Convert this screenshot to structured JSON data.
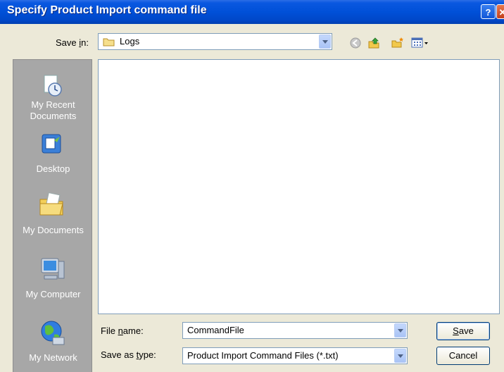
{
  "window": {
    "title": "Specify Product Import command file"
  },
  "save_in": {
    "label_pre": "Save ",
    "label_u": "i",
    "label_post": "n:",
    "value": "Logs"
  },
  "toolbar": {
    "back_icon": "back-icon",
    "up_icon": "up-folder-icon",
    "new_folder_icon": "new-folder-icon",
    "views_icon": "views-menu-icon"
  },
  "places": [
    {
      "label_line1": "My Recent",
      "label_line2": "Documents",
      "icon": "recent-documents-icon"
    },
    {
      "label_line1": "Desktop",
      "label_line2": "",
      "icon": "desktop-icon"
    },
    {
      "label_line1": "My Documents",
      "label_line2": "",
      "icon": "my-documents-icon"
    },
    {
      "label_line1": "My Computer",
      "label_line2": "",
      "icon": "my-computer-icon"
    },
    {
      "label_line1": "My Network",
      "label_line2": "",
      "icon": "my-network-icon"
    }
  ],
  "file_name": {
    "label_pre": "File ",
    "label_u": "n",
    "label_post": "ame:",
    "value": "CommandFile"
  },
  "save_type": {
    "label_pre": "Save as ",
    "label_u": "t",
    "label_post": "ype:",
    "value": "Product Import Command Files (*.txt)"
  },
  "buttons": {
    "save_u": "S",
    "save_rest": "ave",
    "cancel": "Cancel"
  }
}
